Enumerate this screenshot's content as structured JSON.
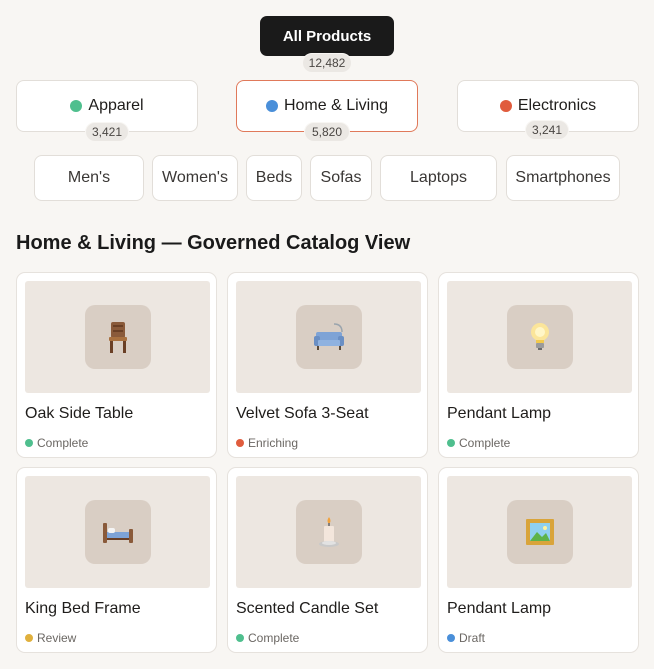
{
  "root": {
    "label": "All Products",
    "count": "12,482"
  },
  "categories": [
    {
      "label": "Apparel",
      "count": "3,421",
      "color": "#4fbf8e",
      "active": false
    },
    {
      "label": "Home & Living",
      "count": "5,820",
      "color": "#4a8fd9",
      "active": true
    },
    {
      "label": "Electronics",
      "count": "3,241",
      "color": "#e05c3d",
      "active": false
    }
  ],
  "subcategories": [
    "Men's",
    "Women's",
    "Beds",
    "Sofas",
    "Laptops",
    "Smartphones"
  ],
  "section_title": "Home & Living — Governed Catalog View",
  "status_colors": {
    "Complete": "#4fbf8e",
    "Enriching": "#e05c3d",
    "Review": "#e0b03d",
    "Draft": "#4a8fd9"
  },
  "products": [
    {
      "name": "Oak Side Table",
      "status": "Complete",
      "icon": "chair-icon"
    },
    {
      "name": "Velvet Sofa 3-Seat",
      "status": "Enriching",
      "icon": "sofa-icon"
    },
    {
      "name": "Pendant Lamp",
      "status": "Complete",
      "icon": "lightbulb-icon"
    },
    {
      "name": "King Bed Frame",
      "status": "Review",
      "icon": "bed-icon"
    },
    {
      "name": "Scented Candle Set",
      "status": "Complete",
      "icon": "candle-icon"
    },
    {
      "name": "Pendant Lamp",
      "status": "Draft",
      "icon": "framed-picture-icon"
    }
  ]
}
